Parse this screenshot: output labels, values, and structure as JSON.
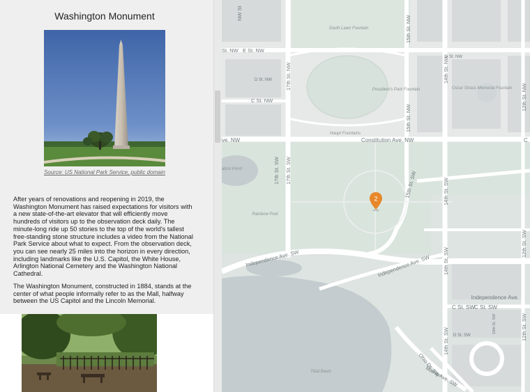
{
  "panel": {
    "title": "Washington Monument",
    "image_caption": "Source: US National Park Service, public domain",
    "paragraphs": [
      "After years of renovations and reopening in 2019, the Washington Monument has raised expectations for visitors with a new state-of-the-art elevator that will efficiently move hundreds of visitors up to the observation deck daily. The minute-long ride up 50 stories to the top of the world's tallest free-standing stone structure includes a video from the National Park Service about what to expect. From the observation deck, you can see nearly 25 miles into the horizon in every direction, including landmarks like the U.S. Capitol, the White House, Arlington National Cemetery and the Washington National Cathedral.",
      "The Washington Monument, constructed in 1884, stands at the center of what people informally refer to as the Mall, halfway between the US Capitol and the Lincoln Memorial."
    ]
  },
  "map": {
    "marker_label": "2",
    "marker_color": "#e8872a",
    "streets": {
      "st_nw_e": "St. NW",
      "e_st_nw": "E St. NW",
      "d_st_nw": "D St. NW",
      "c_st_nw": "C St. NW",
      "constitution": "Constitution Ave. NW",
      "constitution_left": "ve. NW",
      "seventeenth": "17th St. NW",
      "fifteenth": "15th St. NW",
      "fourteenth": "14th St. NW",
      "twelfth": "12th St. NW",
      "seventeenth_sw": "17th St. SW",
      "fifteenth_sw": "15th St. SW",
      "fourteenth_sw": "14th St. SW",
      "twelfth_sw": "12th St. SW",
      "independence_left": "Independence Ave. SW",
      "independence_mid": "Independence Ave. SW",
      "independence_right": "Independence Ave.",
      "c_st_sw_1": "C St. SW",
      "c_st_sw_2": "C St. SW",
      "d_st_sw": "D St. SW",
      "ohio": "Ohio Dr. SW",
      "maine": "Maine Ave. SW",
      "nw_top": "NW St",
      "d_st_nw_right": "D St. NW",
      "c": "C",
      "tenth": "10th St. SW"
    },
    "places": {
      "south_lawn": "South Lawn Fountain",
      "presidents_park": "President's Park Fountain",
      "oscar_straus": "Oscar Straus Memorial Fountain",
      "haupt": "Haupt Fountains",
      "rainbow_pool": "Rainbow Pool",
      "reflecting": "ation Pond",
      "tidal_basin": "Tidal Basin"
    }
  }
}
